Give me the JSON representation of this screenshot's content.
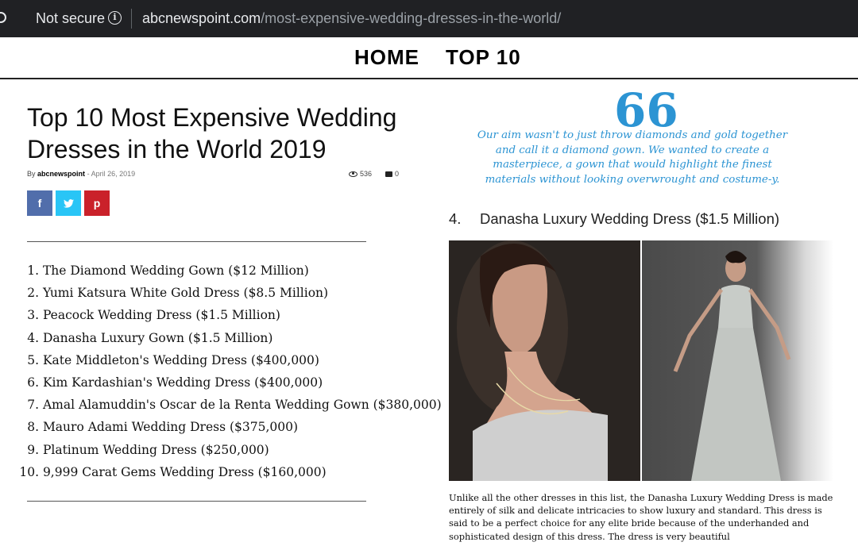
{
  "browser": {
    "security_label": "Not secure",
    "url_host": "abcnewspoint.com",
    "url_path": "/most-expensive-wedding-dresses-in-the-world/"
  },
  "nav": {
    "items": [
      "HOME",
      "TOP 10"
    ]
  },
  "article": {
    "title": "Top 10 Most Expensive Wedding Dresses in the World 2019",
    "by_label": "By",
    "author": "abcnewspoint",
    "separator": "-",
    "date": "April 26, 2019",
    "views": "536",
    "comments": "0"
  },
  "share": {
    "facebook": "f",
    "twitter": "t",
    "pinterest": "p"
  },
  "toc": [
    {
      "num": "1.",
      "text": "The Diamond Wedding Gown ($12 Million)"
    },
    {
      "num": "2.",
      "text": "Yumi Katsura White Gold Dress ($8.5 Million)"
    },
    {
      "num": "3.",
      "text": "Peacock Wedding Dress ($1.5 Million)"
    },
    {
      "num": "4.",
      "text": "Danasha Luxury Gown ($1.5 Million)"
    },
    {
      "num": "5.",
      "text": "Kate Middleton's Wedding Dress ($400,000)"
    },
    {
      "num": "6.",
      "text": "Kim Kardashian's Wedding Dress ($400,000)"
    },
    {
      "num": "7.",
      "text": "Amal Alamuddin's Oscar de la Renta Wedding Gown ($380,000)"
    },
    {
      "num": "8.",
      "text": "Mauro Adami Wedding Dress ($375,000)"
    },
    {
      "num": "9.",
      "text": "Platinum Wedding Dress ($250,000)"
    },
    {
      "num": "10.",
      "text": "9,999 Carat Gems Wedding Dress ($160,000)"
    }
  ],
  "quote": {
    "mark": "66",
    "text": "Our aim wasn't to just throw diamonds and gold together and call it a diamond gown. We wanted to create a masterpiece, a gown that would highlight the finest materials without looking overwrought and costume-y."
  },
  "section": {
    "number": "4.",
    "title": "Danasha Luxury Wedding Dress ($1.5 Million)"
  },
  "body": {
    "text": "Unlike all the other dresses in this list, the Danasha Luxury Wedding Dress is made entirely of silk and delicate intricacies to show luxury and standard. This dress is said to be a perfect choice for any elite bride because of the underhanded and sophisticated design of this dress. The dress is very beautiful"
  },
  "colors": {
    "browser_bar": "#202124",
    "accent_blue": "#2c94d3",
    "facebook": "#516eab",
    "twitter": "#29c5f6",
    "pinterest": "#ca212a"
  }
}
